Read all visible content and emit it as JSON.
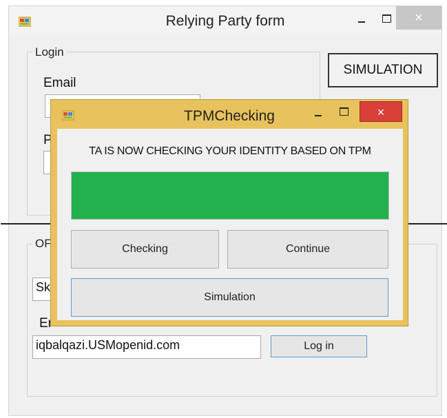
{
  "main_window": {
    "title": "Relying Party form",
    "icon": "windows-form-icon",
    "close_glyph": "×",
    "login_group": {
      "label": "Login",
      "email_label": "Email",
      "email_value": "",
      "password_label_visible": "P",
      "password_value": ""
    },
    "simulation_button": "SIMULATION",
    "openid_group": {
      "label_visible": "OF",
      "provider_value_visible": "Sk",
      "email_label_visible": "Er",
      "openid_value": "iqbalqazi.USMopenid.com",
      "login_button": "Log in"
    }
  },
  "dialog": {
    "title": "TPMChecking",
    "icon": "windows-form-icon",
    "close_glyph": "×",
    "message": "TA IS NOW CHECKING YOUR IDENTITY BASED ON TPM",
    "progress_fraction": 1.0,
    "buttons": {
      "checking": "Checking",
      "continue": "Continue",
      "simulation": "Simulation"
    }
  },
  "colors": {
    "progress": "#22b14c",
    "dialog_frame": "#e8c25c",
    "dialog_close": "#d9403a",
    "focus_border": "#5b9bd5"
  }
}
